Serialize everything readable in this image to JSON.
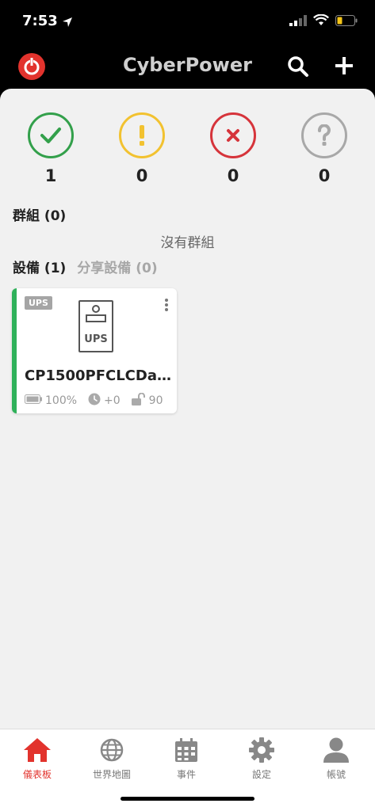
{
  "status_bar": {
    "time": "7:53"
  },
  "nav": {
    "brand": "CyberPower"
  },
  "status_summary": [
    {
      "key": "normal",
      "count": "1",
      "color": "#33a04b",
      "icon": "check-icon"
    },
    {
      "key": "warning",
      "count": "0",
      "color": "#f2c230",
      "icon": "exclamation-icon"
    },
    {
      "key": "critical",
      "count": "0",
      "color": "#d6343b",
      "icon": "x-icon"
    },
    {
      "key": "unknown",
      "count": "0",
      "color": "#a8a8a8",
      "icon": "question-icon"
    }
  ],
  "groups": {
    "title": "群組 (0)",
    "empty_text": "沒有群組"
  },
  "device_tabs": {
    "devices": "設備 (1)",
    "shared": "分享設備 (0)"
  },
  "device_card": {
    "badge": "UPS",
    "icon_label": "UPS",
    "name": "CP1500PFCLCDa...",
    "battery": "100%",
    "runtime": "+0",
    "load": "90",
    "status_color": "#2fb15a"
  },
  "tabbar": {
    "items": [
      {
        "label": "儀表板",
        "icon": "home-icon",
        "active": true
      },
      {
        "label": "世界地圖",
        "icon": "globe-icon",
        "active": false
      },
      {
        "label": "事件",
        "icon": "calendar-icon",
        "active": false
      },
      {
        "label": "設定",
        "icon": "gear-icon",
        "active": false
      },
      {
        "label": "帳號",
        "icon": "user-icon",
        "active": false
      }
    ]
  }
}
